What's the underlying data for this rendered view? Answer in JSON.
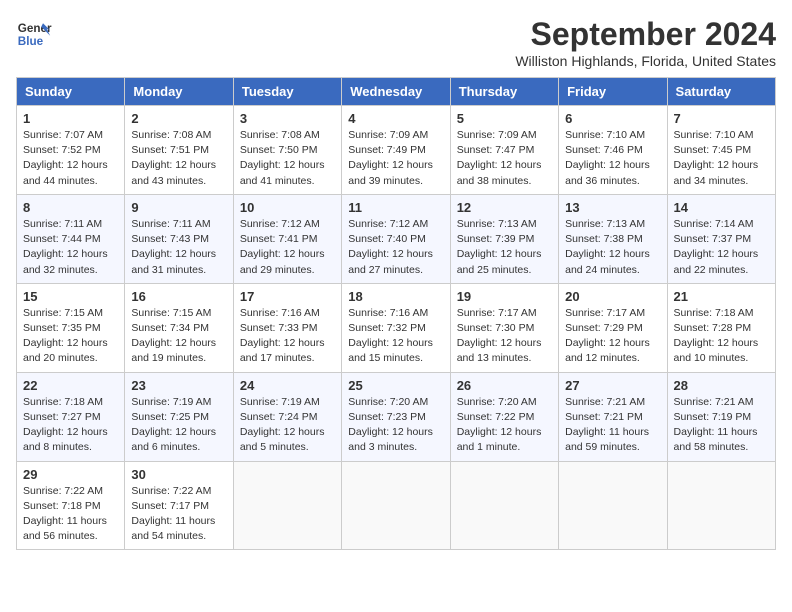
{
  "header": {
    "logo_line1": "General",
    "logo_line2": "Blue",
    "month_title": "September 2024",
    "location": "Williston Highlands, Florida, United States"
  },
  "days_of_week": [
    "Sunday",
    "Monday",
    "Tuesday",
    "Wednesday",
    "Thursday",
    "Friday",
    "Saturday"
  ],
  "weeks": [
    [
      {
        "day": "1",
        "info": "Sunrise: 7:07 AM\nSunset: 7:52 PM\nDaylight: 12 hours\nand 44 minutes."
      },
      {
        "day": "2",
        "info": "Sunrise: 7:08 AM\nSunset: 7:51 PM\nDaylight: 12 hours\nand 43 minutes."
      },
      {
        "day": "3",
        "info": "Sunrise: 7:08 AM\nSunset: 7:50 PM\nDaylight: 12 hours\nand 41 minutes."
      },
      {
        "day": "4",
        "info": "Sunrise: 7:09 AM\nSunset: 7:49 PM\nDaylight: 12 hours\nand 39 minutes."
      },
      {
        "day": "5",
        "info": "Sunrise: 7:09 AM\nSunset: 7:47 PM\nDaylight: 12 hours\nand 38 minutes."
      },
      {
        "day": "6",
        "info": "Sunrise: 7:10 AM\nSunset: 7:46 PM\nDaylight: 12 hours\nand 36 minutes."
      },
      {
        "day": "7",
        "info": "Sunrise: 7:10 AM\nSunset: 7:45 PM\nDaylight: 12 hours\nand 34 minutes."
      }
    ],
    [
      {
        "day": "8",
        "info": "Sunrise: 7:11 AM\nSunset: 7:44 PM\nDaylight: 12 hours\nand 32 minutes."
      },
      {
        "day": "9",
        "info": "Sunrise: 7:11 AM\nSunset: 7:43 PM\nDaylight: 12 hours\nand 31 minutes."
      },
      {
        "day": "10",
        "info": "Sunrise: 7:12 AM\nSunset: 7:41 PM\nDaylight: 12 hours\nand 29 minutes."
      },
      {
        "day": "11",
        "info": "Sunrise: 7:12 AM\nSunset: 7:40 PM\nDaylight: 12 hours\nand 27 minutes."
      },
      {
        "day": "12",
        "info": "Sunrise: 7:13 AM\nSunset: 7:39 PM\nDaylight: 12 hours\nand 25 minutes."
      },
      {
        "day": "13",
        "info": "Sunrise: 7:13 AM\nSunset: 7:38 PM\nDaylight: 12 hours\nand 24 minutes."
      },
      {
        "day": "14",
        "info": "Sunrise: 7:14 AM\nSunset: 7:37 PM\nDaylight: 12 hours\nand 22 minutes."
      }
    ],
    [
      {
        "day": "15",
        "info": "Sunrise: 7:15 AM\nSunset: 7:35 PM\nDaylight: 12 hours\nand 20 minutes."
      },
      {
        "day": "16",
        "info": "Sunrise: 7:15 AM\nSunset: 7:34 PM\nDaylight: 12 hours\nand 19 minutes."
      },
      {
        "day": "17",
        "info": "Sunrise: 7:16 AM\nSunset: 7:33 PM\nDaylight: 12 hours\nand 17 minutes."
      },
      {
        "day": "18",
        "info": "Sunrise: 7:16 AM\nSunset: 7:32 PM\nDaylight: 12 hours\nand 15 minutes."
      },
      {
        "day": "19",
        "info": "Sunrise: 7:17 AM\nSunset: 7:30 PM\nDaylight: 12 hours\nand 13 minutes."
      },
      {
        "day": "20",
        "info": "Sunrise: 7:17 AM\nSunset: 7:29 PM\nDaylight: 12 hours\nand 12 minutes."
      },
      {
        "day": "21",
        "info": "Sunrise: 7:18 AM\nSunset: 7:28 PM\nDaylight: 12 hours\nand 10 minutes."
      }
    ],
    [
      {
        "day": "22",
        "info": "Sunrise: 7:18 AM\nSunset: 7:27 PM\nDaylight: 12 hours\nand 8 minutes."
      },
      {
        "day": "23",
        "info": "Sunrise: 7:19 AM\nSunset: 7:25 PM\nDaylight: 12 hours\nand 6 minutes."
      },
      {
        "day": "24",
        "info": "Sunrise: 7:19 AM\nSunset: 7:24 PM\nDaylight: 12 hours\nand 5 minutes."
      },
      {
        "day": "25",
        "info": "Sunrise: 7:20 AM\nSunset: 7:23 PM\nDaylight: 12 hours\nand 3 minutes."
      },
      {
        "day": "26",
        "info": "Sunrise: 7:20 AM\nSunset: 7:22 PM\nDaylight: 12 hours\nand 1 minute."
      },
      {
        "day": "27",
        "info": "Sunrise: 7:21 AM\nSunset: 7:21 PM\nDaylight: 11 hours\nand 59 minutes."
      },
      {
        "day": "28",
        "info": "Sunrise: 7:21 AM\nSunset: 7:19 PM\nDaylight: 11 hours\nand 58 minutes."
      }
    ],
    [
      {
        "day": "29",
        "info": "Sunrise: 7:22 AM\nSunset: 7:18 PM\nDaylight: 11 hours\nand 56 minutes."
      },
      {
        "day": "30",
        "info": "Sunrise: 7:22 AM\nSunset: 7:17 PM\nDaylight: 11 hours\nand 54 minutes."
      },
      null,
      null,
      null,
      null,
      null
    ]
  ]
}
